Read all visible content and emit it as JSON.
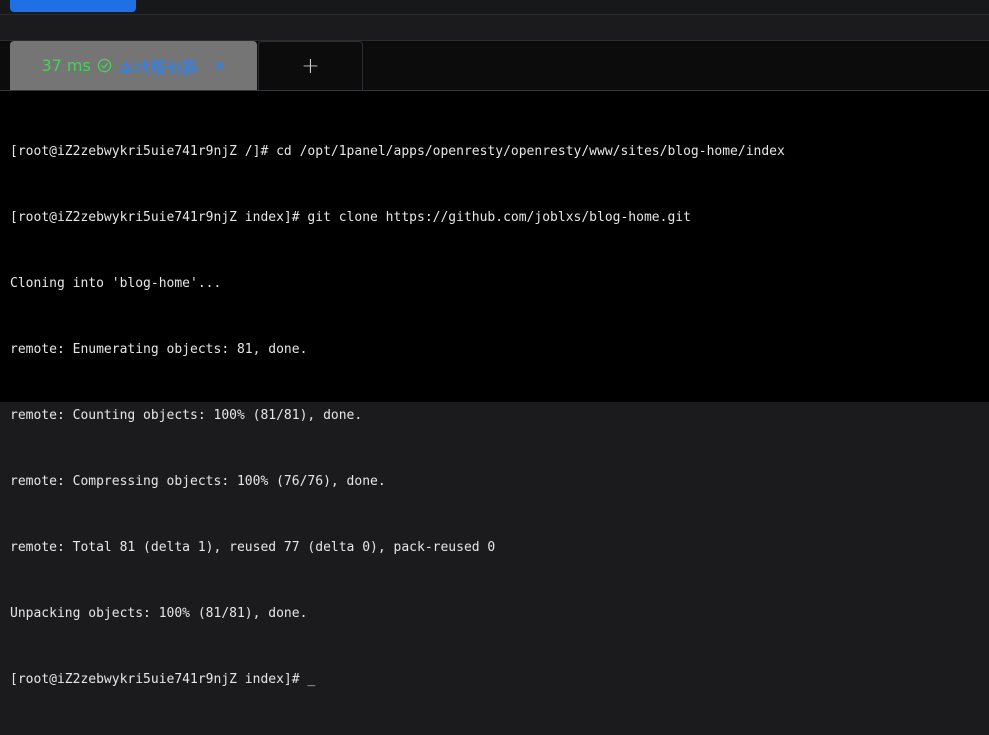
{
  "tab": {
    "latency": "37 ms",
    "status_icon": "check-circle-icon",
    "server_name": "本地服务器",
    "close_glyph": "×",
    "add_glyph": "+"
  },
  "colors": {
    "accent_blue": "#1f6fe5",
    "status_green": "#48d25d",
    "terminal_bg": "#000000"
  },
  "terminal": {
    "lines": [
      "[root@iZ2zebwykri5uie741r9njZ /]# cd /opt/1panel/apps/openresty/openresty/www/sites/blog-home/index",
      "[root@iZ2zebwykri5uie741r9njZ index]# git clone https://github.com/joblxs/blog-home.git",
      "Cloning into 'blog-home'...",
      "remote: Enumerating objects: 81, done.",
      "remote: Counting objects: 100% (81/81), done.",
      "remote: Compressing objects: 100% (76/76), done.",
      "remote: Total 81 (delta 1), reused 77 (delta 0), pack-reused 0",
      "Unpacking objects: 100% (81/81), done.",
      "[root@iZ2zebwykri5uie741r9njZ index]# "
    ],
    "cursor": "_"
  }
}
